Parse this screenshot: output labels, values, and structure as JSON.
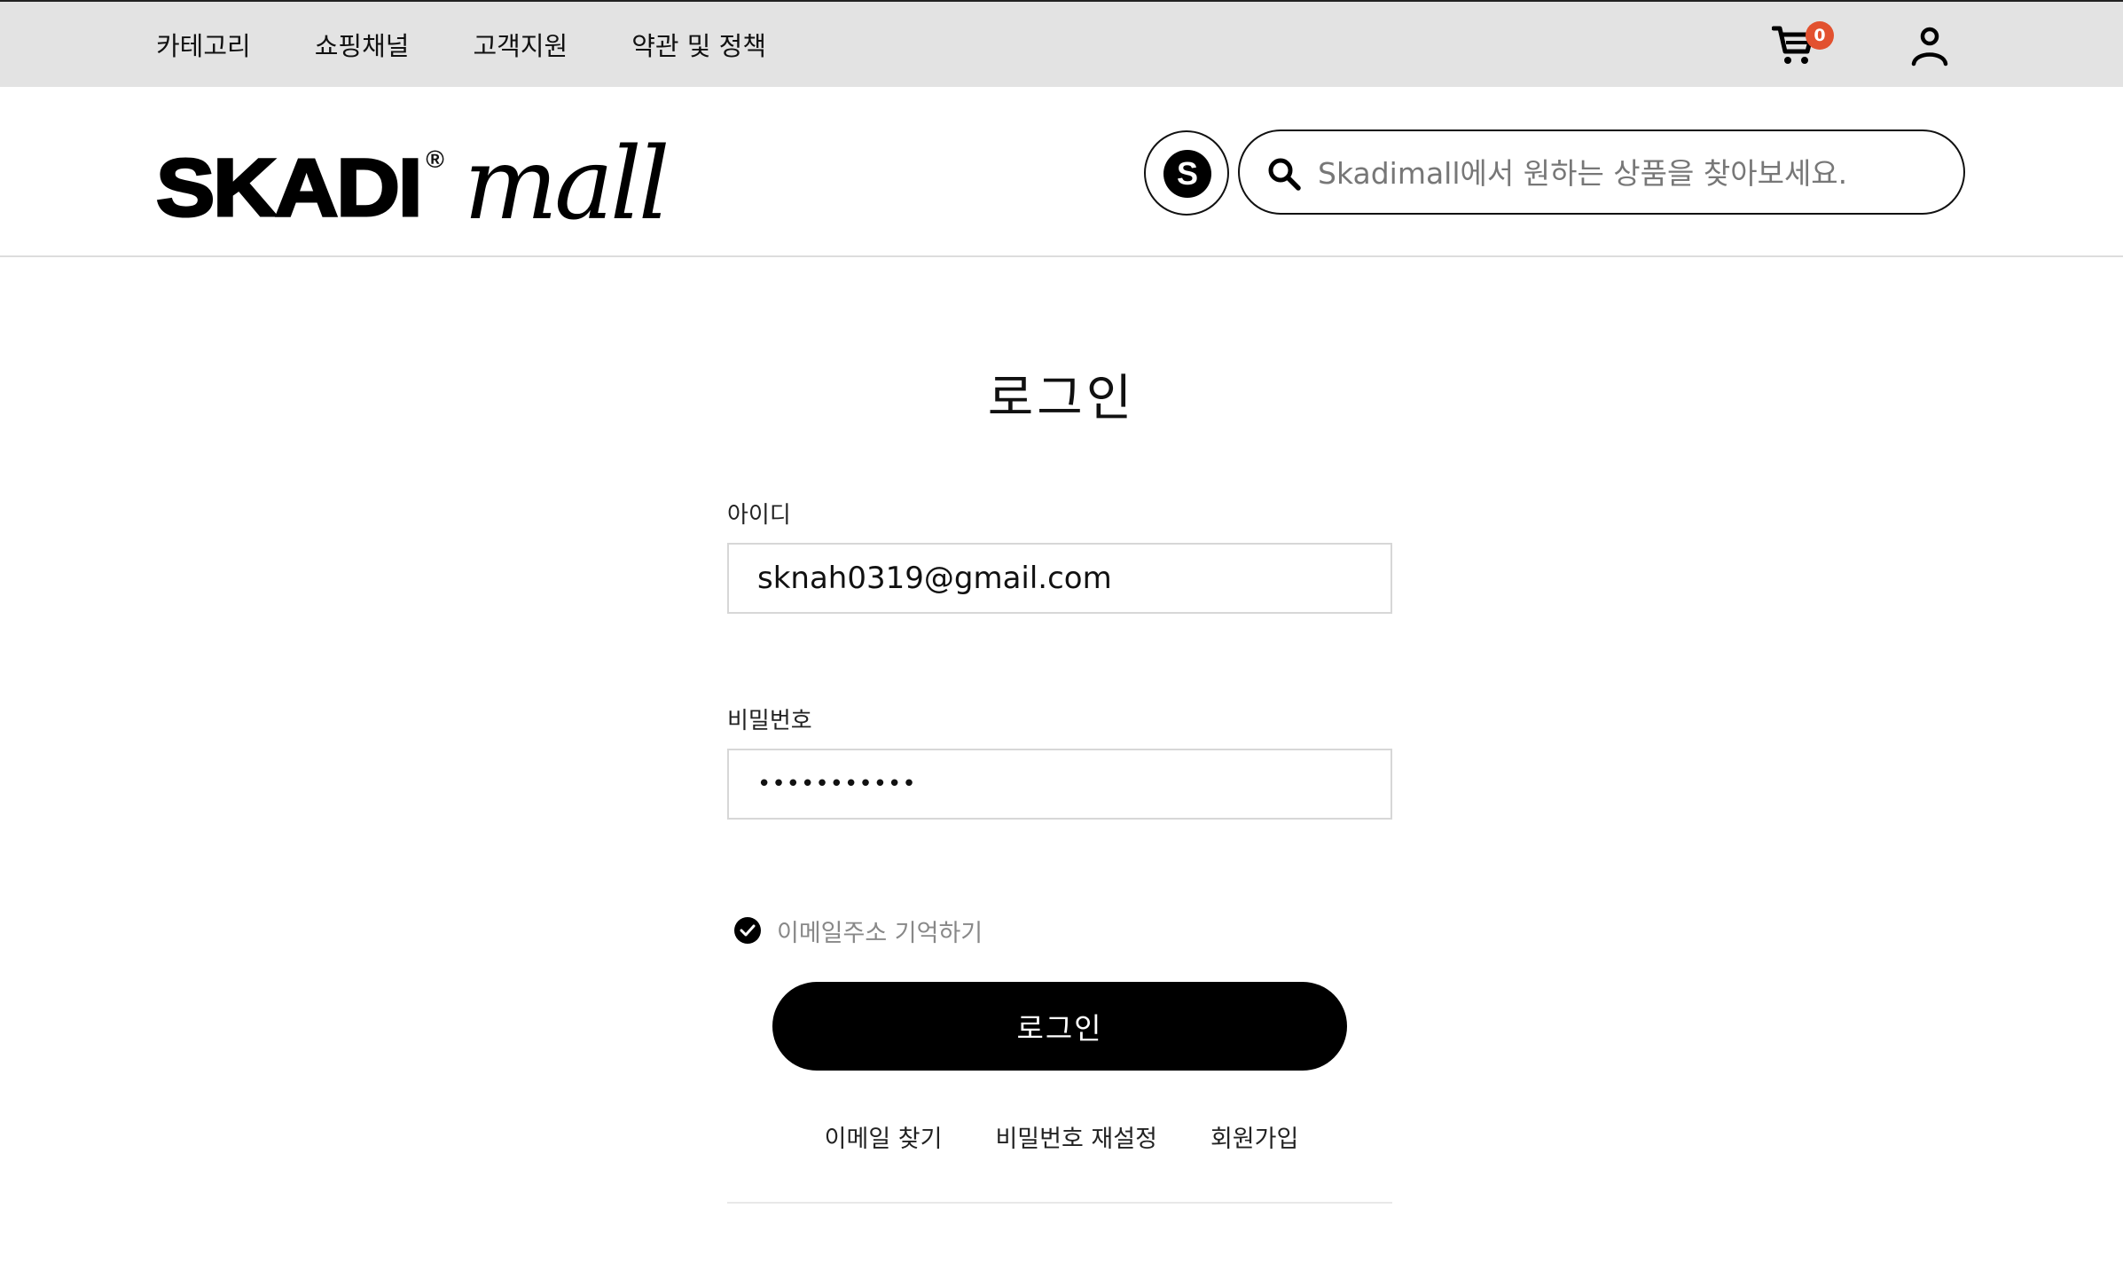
{
  "topbar": {
    "nav": [
      "카테고리",
      "쇼핑채널",
      "고객지원",
      "약관 및 정책"
    ],
    "cart_count": "0",
    "cart_icon": "cart-icon",
    "user_icon": "user-icon",
    "badge_color": "#e2512f"
  },
  "header": {
    "logo_brand": "SKADI",
    "logo_reg": "®",
    "logo_suffix": "mall",
    "s_badge": "S",
    "search_placeholder": "Skadimall에서 원하는 상품을 찾아보세요."
  },
  "login": {
    "title": "로그인",
    "id_label": "아이디",
    "id_value": "sknah0319@gmail.com",
    "password_label": "비밀번호",
    "password_value": "•••••••••••",
    "remember_label": "이메일주소 기억하기",
    "remember_checked": true,
    "submit_label": "로그인",
    "links": [
      "이메일 찾기",
      "비밀번호 재설정",
      "회원가입"
    ]
  }
}
